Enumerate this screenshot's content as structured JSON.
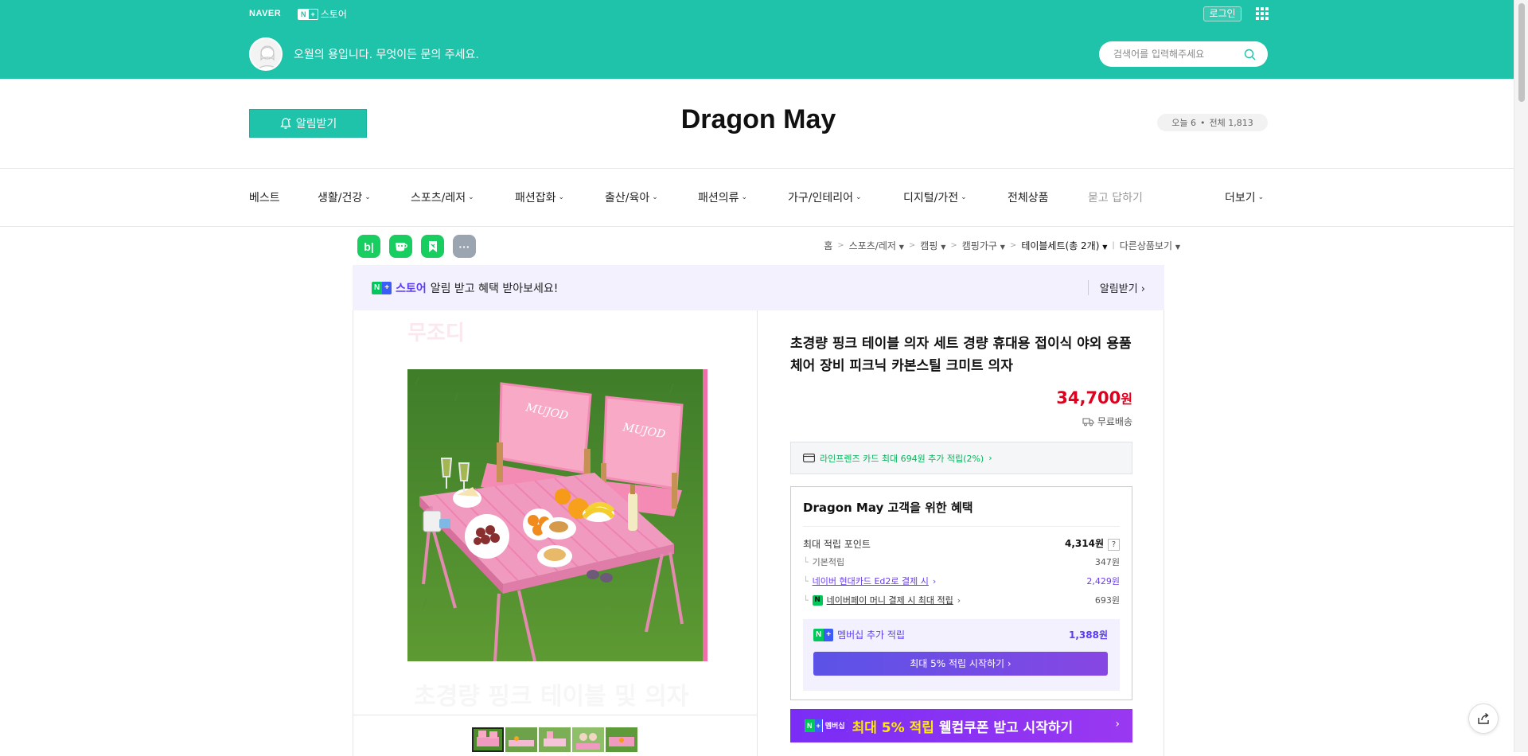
{
  "topbar": {
    "naver_logo": "NAVER",
    "store_badge_n": "N",
    "store_badge_plus": "+",
    "store_label": "스토어",
    "login_label": "로그인",
    "welcome_text": "오월의 용입니다. 무엇이든 문의 주세요.",
    "search_placeholder": "검색어를 입력해주세요",
    "bg_color": "#1ec3a9"
  },
  "header": {
    "notify_button": "알림받기",
    "store_name": "Dragon May",
    "visits_today": "오늘 6",
    "visits_total": "전체 1,813"
  },
  "nav": {
    "items": [
      {
        "label": "베스트"
      },
      {
        "label": "생활/건강"
      },
      {
        "label": "스포츠/레저"
      },
      {
        "label": "패션잡화"
      },
      {
        "label": "출산/육아"
      },
      {
        "label": "패션의류"
      },
      {
        "label": "가구/인테리어"
      },
      {
        "label": "디지털/가전"
      },
      {
        "label": "전체상품"
      },
      {
        "label": "묻고 답하기"
      }
    ],
    "more_label": "더보기"
  },
  "social": {
    "icons": [
      "blog-icon",
      "talk-icon",
      "bookmark-icon",
      "more-dots-icon"
    ],
    "blog_text": "b|",
    "more_text": "···"
  },
  "breadcrumb": {
    "home": "홈",
    "cat1": "스포츠/레저",
    "cat2": "캠핑",
    "cat3": "캠핑가구",
    "cat4": "테이블세트(총 2개)",
    "other": "다른상품보기"
  },
  "promo": {
    "store_label": "스토어",
    "text": "알림 받고 혜택 받아보세요!",
    "action": "알림받기"
  },
  "product": {
    "faint_brand": "무조디",
    "faint_caption": "초경량 핑크 테이블 및 의자",
    "title": "초경량 핑크 테이블 의자 세트 경량 휴대용 접이식 야외 용품 체어 장비 피크닉 카본스틸 크미트 의자",
    "price_number": "34,700",
    "price_unit": "원",
    "shipping": "무료배송",
    "card_benefit": "라인프렌즈 카드 최대 694원 추가 적립(2%)",
    "chair_print": "MUJOD"
  },
  "benefits": {
    "title": "Dragon May 고객을 위한 혜택",
    "max_points_label": "최대 적립 포인트",
    "max_points_value": "4,314원",
    "qmark": "?",
    "rows": [
      {
        "label": "기본적립",
        "value": "347원"
      },
      {
        "label": "네이버 현대카드 Ed2로 결제 시",
        "value": "2,429원"
      },
      {
        "label": "네이버페이 머니 결제 시 최대 적립",
        "value": "693원"
      }
    ],
    "membership_label": "멤버십 추가 적립",
    "membership_value": "1,388원",
    "membership_button": "최대 5% 적립 시작하기"
  },
  "banner": {
    "badge_text": "멤버십",
    "highlight": "최대 5% 적립",
    "text": "웰컴쿠폰 받고 시작하기",
    "arrow": "›"
  },
  "colors": {
    "brand_green": "#1ec3a9",
    "price_red": "#e0001d",
    "naver_green": "#03c75a",
    "membership_purple": "#7a2df5"
  }
}
